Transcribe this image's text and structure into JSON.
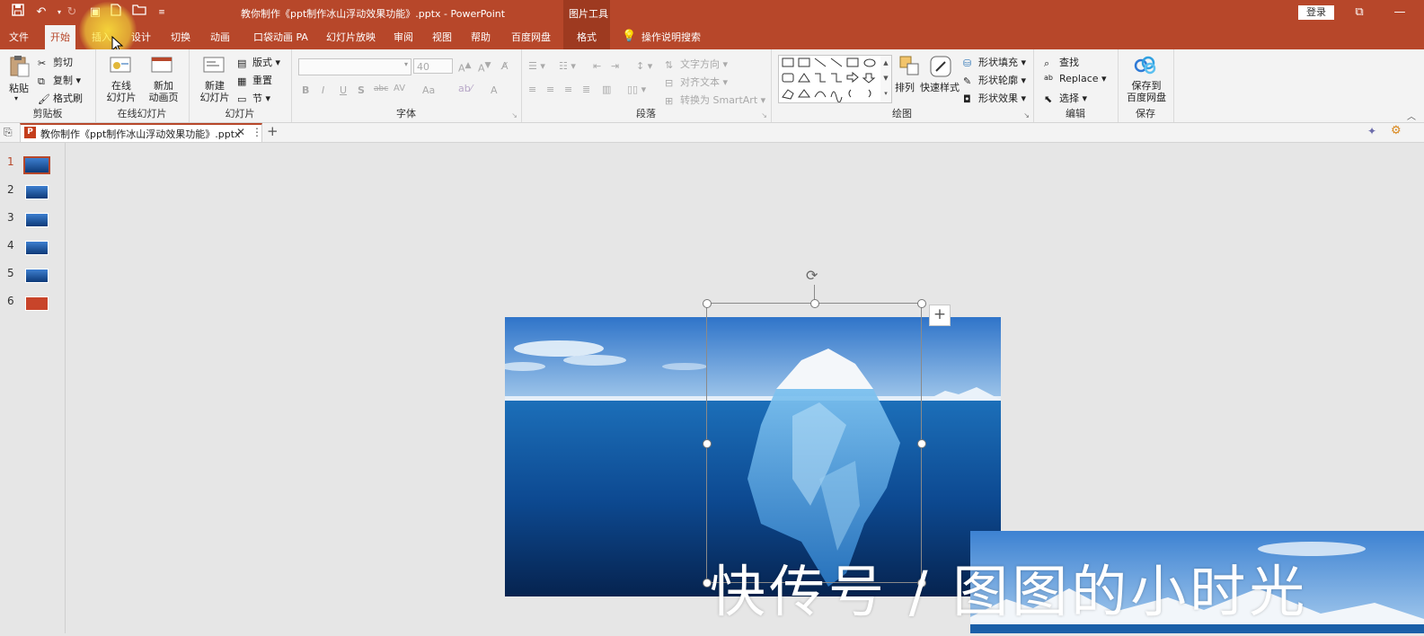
{
  "title": "教你制作《ppt制作冰山浮动效果功能》.pptx  -  PowerPoint",
  "context_tab_group": "图片工具",
  "login_button": "登录",
  "tabs": [
    "文件",
    "开始",
    "插入",
    "设计",
    "切换",
    "动画",
    "口袋动画 PA",
    "幻灯片放映",
    "审阅",
    "视图",
    "帮助",
    "百度网盘",
    "格式"
  ],
  "tell_me": "操作说明搜索",
  "ribbon": {
    "clipboard": {
      "paste": "粘贴",
      "cut": "剪切",
      "copy": "复制",
      "format_painter": "格式刷",
      "label": "剪贴板"
    },
    "online": {
      "online_slides": "在线\n幻灯片",
      "new_anim": "新加\n动画页",
      "label": "在线幻灯片"
    },
    "slides": {
      "new_slide": "新建\n幻灯片",
      "layout": "版式",
      "reset": "重置",
      "section": "节",
      "label": "幻灯片"
    },
    "font": {
      "font_size": "40",
      "label": "字体",
      "buttons": [
        "B",
        "I",
        "U",
        "S",
        "abc",
        "AV",
        "Aa",
        "A"
      ]
    },
    "paragraph": {
      "text_direction": "文字方向",
      "align_text": "对齐文本",
      "smartart": "转换为 SmartArt",
      "label": "段落"
    },
    "drawing": {
      "arrange": "排列",
      "quick_styles": "快速样式",
      "shape_fill": "形状填充",
      "shape_outline": "形状轮廓",
      "shape_effects": "形状效果",
      "label": "绘图"
    },
    "editing": {
      "find": "查找",
      "replace": "Replace",
      "select": "选择",
      "label": "编辑"
    },
    "save": {
      "save_to": "保存到\n百度网盘",
      "label": "保存"
    }
  },
  "doc_tab": "教你制作《ppt制作冰山浮动效果功能》.pptx",
  "slide_numbers": [
    "1",
    "2",
    "3",
    "4",
    "5",
    "6"
  ],
  "watermark": "快传号 / 图图的小时光",
  "colors": {
    "accent": "#b7472a",
    "ribbon_bg": "#f3f3f3",
    "canvas_bg": "#e6e6e6"
  }
}
